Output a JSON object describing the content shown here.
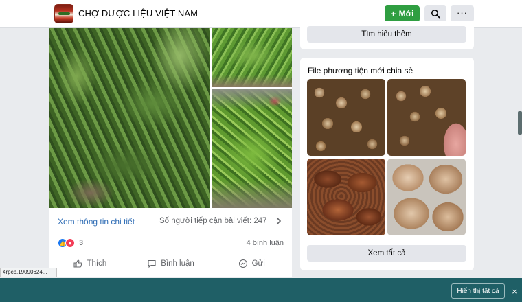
{
  "header": {
    "group_name": "CHỢ DƯỢC LIỆU VIỆT NAM",
    "new_button": "Mới",
    "new_button_icon": "plus-icon",
    "search_icon": "search-icon",
    "more_icon": "more-dots-icon",
    "accent_color": "#2f9e41"
  },
  "post": {
    "details_link": "Xem thông tin chi tiết",
    "reach_text": "Số người tiếp cận bài viết: 247",
    "reaction_count": "3",
    "comment_count": "4 bình luận",
    "actions": {
      "like": "Thích",
      "comment": "Bình luận",
      "send": "Gửi"
    }
  },
  "sidebar": {
    "learn_more": "Tìm hiểu thêm",
    "media_title": "File phương tiện mới chia sẻ",
    "see_all": "Xem tất cả"
  },
  "status": {
    "url_tooltip": "4rpcb.19090624...",
    "show_all_button": "Hiển thị tất cả",
    "close_label": "×",
    "bar_color": "#1f5f66"
  }
}
